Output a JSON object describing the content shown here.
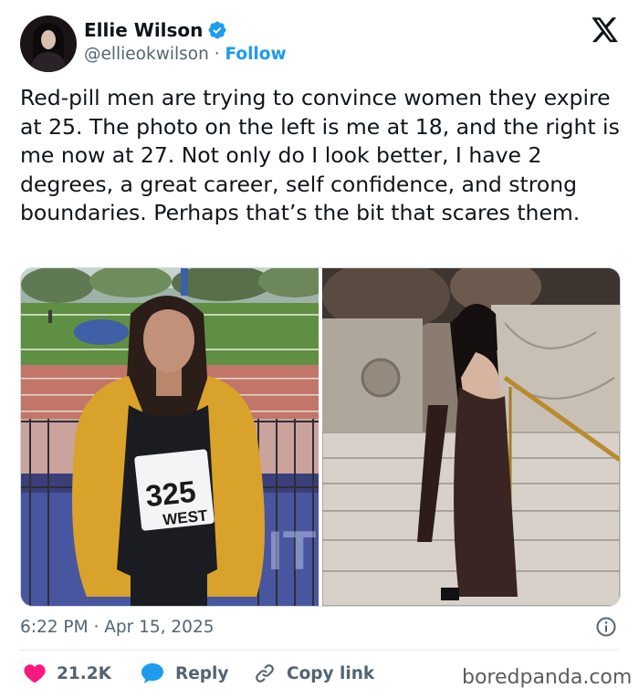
{
  "author": {
    "name": "Ellie Wilson",
    "handle": "@ellieokwilson",
    "separator": "·",
    "follow_label": "Follow"
  },
  "tweet": {
    "text": "Red-pill men are trying to convince women they expire at 25. The photo on the left is me at 18, and the right is me now at 27. Not only do I look better, I have 2 degrees, a great career, self confidence, and strong boundaries. Perhaps that’s the bit that scares them.",
    "time": "6:22 PM",
    "date_separator": "·",
    "date": "Apr 15, 2025"
  },
  "media": {
    "left_photo": {
      "bib_number": "325",
      "bib_name": "WEST"
    }
  },
  "actions": {
    "like_count": "21.2K",
    "reply_label": "Reply",
    "copy_link_label": "Copy link"
  },
  "watermark": "boredpanda.com",
  "icons": {
    "verified": "verified-badge-icon",
    "logo": "x-logo-icon",
    "info": "info-icon",
    "like": "heart-icon",
    "reply": "speech-bubble-icon",
    "copy": "link-icon"
  },
  "colors": {
    "accent": "#1d9bf0",
    "like": "#f91880",
    "secondary_text": "#536471",
    "divider": "#e7ecf0"
  }
}
